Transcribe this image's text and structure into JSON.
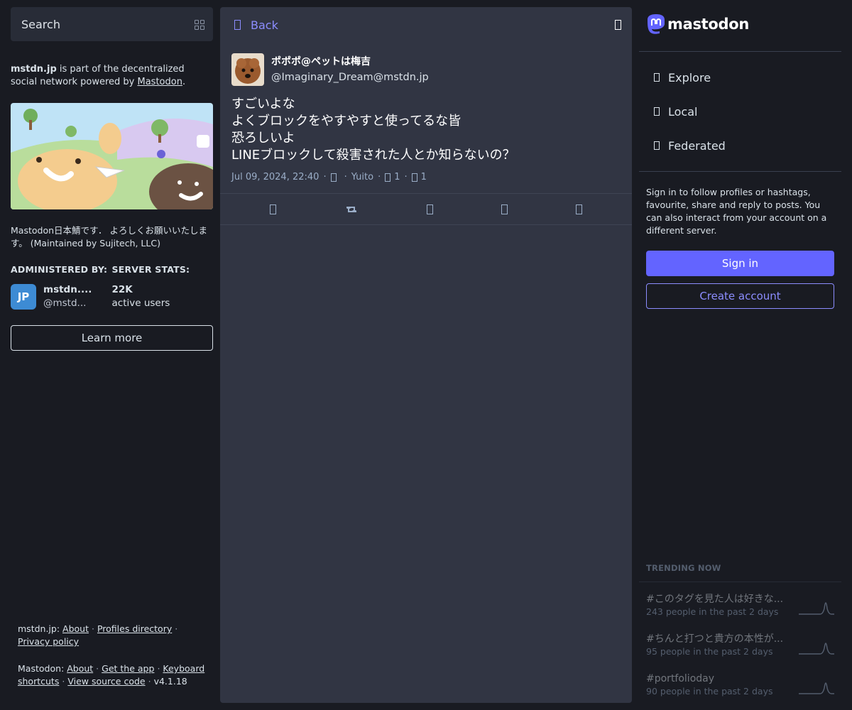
{
  "search": {
    "placeholder": "Search"
  },
  "server": {
    "domain": "mstdn.jp",
    "desc_middle": " is part of the decentralized social network powered by ",
    "powered_link": "Mastodon",
    "desc_end": ".",
    "long_description": "Mastodon日本鯖です． よろしくお願いいたします。 (Maintained by Sujitech, LLC)"
  },
  "stats": {
    "admin_title": "ADMINISTERED BY:",
    "stats_title": "SERVER STATS:",
    "admin_avatar_text": "JP",
    "admin_name": "mstdn....",
    "admin_handle": "@mstd...",
    "users_count": "22K",
    "users_label": "active users"
  },
  "learn_more": "Learn more",
  "footer": {
    "domain_prefix": "mstdn.jp",
    "about": "About",
    "profiles_directory": "Profiles directory",
    "privacy_policy": "Privacy policy",
    "mastodon_prefix": "Mastodon",
    "about2": "About",
    "get_app": "Get the app",
    "keyboard_shortcuts": "Keyboard shortcuts",
    "view_source": "View source code",
    "version": "v4.1.18"
  },
  "column": {
    "back_label": "Back"
  },
  "status": {
    "display_name": "ポポポ@ペットは梅吉",
    "acct": "@Imaginary_Dream@mstdn.jp",
    "lines": [
      "すごいよな",
      "よくブロックをやすやすと使ってるな皆",
      "恐ろしいよ",
      "LINEブロックして殺害された人とか知らないの？"
    ],
    "timestamp": "Jul 09, 2024, 22:40",
    "application": "Yuito",
    "reblogs": "1",
    "favourites": "1"
  },
  "nav": {
    "logo_text": "mastodon",
    "explore": "Explore",
    "local": "Local",
    "federated": "Federated"
  },
  "signin": {
    "prompt": "Sign in to follow profiles or hashtags, favourite, share and reply to posts. You can also interact from your account on a different server.",
    "sign_in": "Sign in",
    "create_account": "Create account"
  },
  "trending": {
    "title": "TRENDING NOW",
    "items": [
      {
        "tag": "#このタグを見た人は好きな...",
        "uses": "243 people in the past 2 days"
      },
      {
        "tag": "#ちんと打つと貴方の本性が...",
        "uses": "95 people in the past 2 days"
      },
      {
        "tag": "#portfolioday",
        "uses": "90 people in the past 2 days"
      }
    ]
  },
  "colors": {
    "accent": "#6364ff",
    "link": "#8c8dff",
    "background": "#191b22",
    "panel": "#313543"
  }
}
